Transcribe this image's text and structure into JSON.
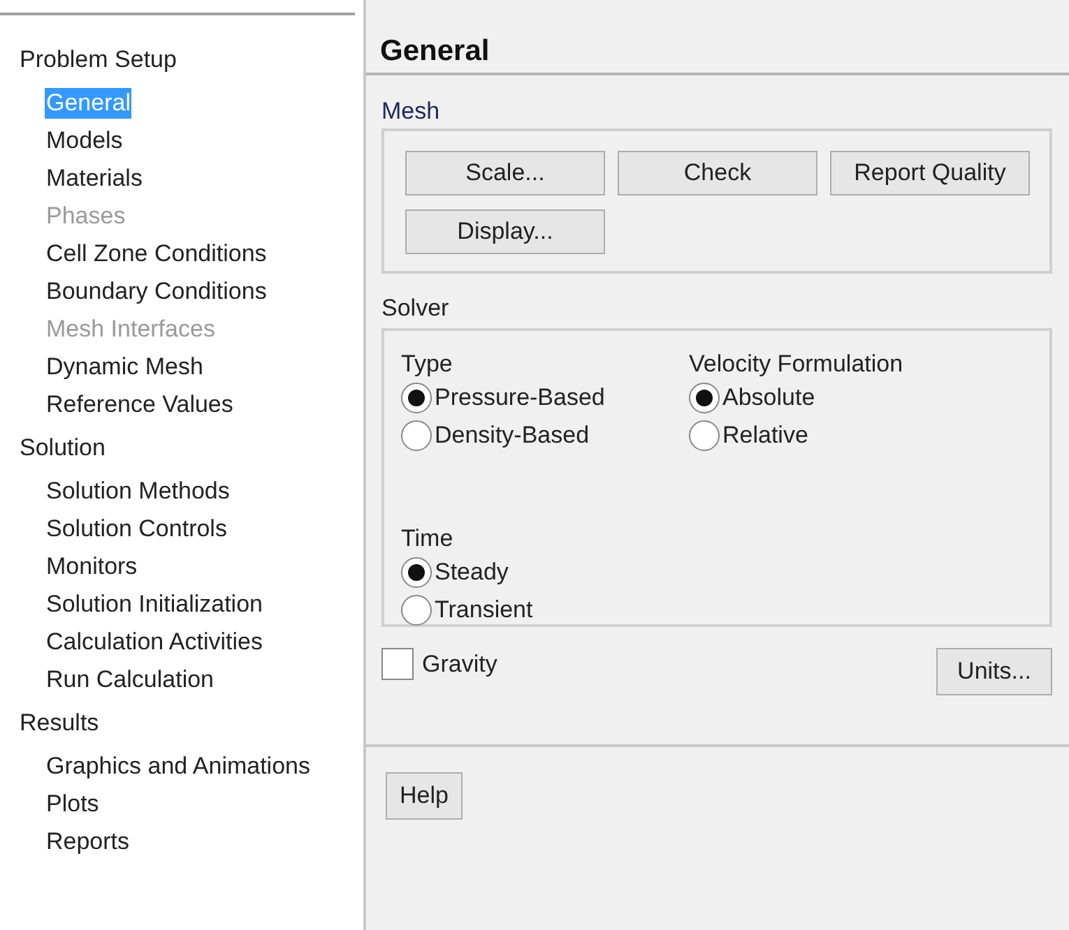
{
  "sidebar": {
    "sections": [
      {
        "label": "Problem Setup",
        "items": [
          {
            "label": "General",
            "selected": true,
            "disabled": false
          },
          {
            "label": "Models",
            "selected": false,
            "disabled": false
          },
          {
            "label": "Materials",
            "selected": false,
            "disabled": false
          },
          {
            "label": "Phases",
            "selected": false,
            "disabled": true
          },
          {
            "label": "Cell Zone Conditions",
            "selected": false,
            "disabled": false
          },
          {
            "label": "Boundary Conditions",
            "selected": false,
            "disabled": false
          },
          {
            "label": "Mesh Interfaces",
            "selected": false,
            "disabled": true
          },
          {
            "label": "Dynamic Mesh",
            "selected": false,
            "disabled": false
          },
          {
            "label": "Reference Values",
            "selected": false,
            "disabled": false
          }
        ]
      },
      {
        "label": "Solution",
        "items": [
          {
            "label": "Solution Methods",
            "selected": false,
            "disabled": false
          },
          {
            "label": "Solution Controls",
            "selected": false,
            "disabled": false
          },
          {
            "label": "Monitors",
            "selected": false,
            "disabled": false
          },
          {
            "label": "Solution Initialization",
            "selected": false,
            "disabled": false
          },
          {
            "label": "Calculation Activities",
            "selected": false,
            "disabled": false
          },
          {
            "label": "Run Calculation",
            "selected": false,
            "disabled": false
          }
        ]
      },
      {
        "label": "Results",
        "items": [
          {
            "label": "Graphics and Animations",
            "selected": false,
            "disabled": false
          },
          {
            "label": "Plots",
            "selected": false,
            "disabled": false
          },
          {
            "label": "Reports",
            "selected": false,
            "disabled": false
          }
        ]
      }
    ]
  },
  "panel": {
    "title": "General",
    "mesh": {
      "label": "Mesh",
      "buttons": [
        "Scale...",
        "Check",
        "Report Quality",
        "Display..."
      ]
    },
    "solver": {
      "label": "Solver",
      "groups": [
        {
          "label": "Type",
          "options": [
            {
              "label": "Pressure-Based",
              "selected": true
            },
            {
              "label": "Density-Based",
              "selected": false
            }
          ]
        },
        {
          "label": "Velocity Formulation",
          "options": [
            {
              "label": "Absolute",
              "selected": true
            },
            {
              "label": "Relative",
              "selected": false
            }
          ]
        },
        {
          "label": "Time",
          "options": [
            {
              "label": "Steady",
              "selected": true
            },
            {
              "label": "Transient",
              "selected": false
            }
          ]
        }
      ]
    },
    "gravity": {
      "label": "Gravity",
      "checked": false
    },
    "units_button": "Units...",
    "help_button": "Help"
  }
}
